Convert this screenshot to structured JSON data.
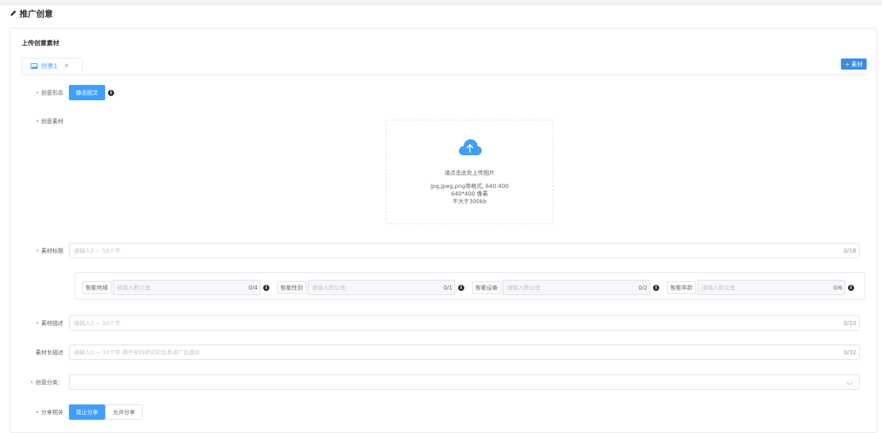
{
  "page": {
    "title": "推广创意"
  },
  "panel": {
    "section_title": "上传创意素材"
  },
  "tab": {
    "label": "创意1",
    "close": "×"
  },
  "add_button": {
    "label": "+ 素材"
  },
  "form": {
    "form_type": {
      "label": "创意形态",
      "button": "静态图文"
    },
    "material": {
      "label": "创意素材"
    },
    "upload": {
      "line1": "请点击此处上传图片",
      "line2": "jpg,jpeg,png等格式, 640:400",
      "line3": "640*400 像素",
      "line4": "不大于300kb"
    },
    "title": {
      "label": "素材标题",
      "placeholder": "请输入2 ~ 18个字",
      "count": "0/18"
    },
    "smart": [
      {
        "tag": "智能地域",
        "placeholder": "请输入默认值",
        "count": "0/4"
      },
      {
        "tag": "智能性别",
        "placeholder": "请输入默认值",
        "count": "0/1"
      },
      {
        "tag": "智能设备",
        "placeholder": "请输入默认值",
        "count": "0/2"
      },
      {
        "tag": "智能年龄",
        "placeholder": "请输入默认值",
        "count": "0/6"
      }
    ],
    "desc": {
      "label": "素材描述",
      "placeholder": "请输入2 ~ 10个字",
      "count": "0/10"
    },
    "long_desc": {
      "label": "素材长描述",
      "placeholder": "请输入0 ~ 32个字,用于单列样式的信息流广告展示",
      "count": "0/32"
    },
    "category": {
      "label": "创意分类：",
      "value": ""
    },
    "share": {
      "label": "分享相关",
      "options": [
        "禁止分享",
        "允许分享"
      ]
    }
  },
  "colors": {
    "primary": "#409eff",
    "required": "#f56c6c",
    "border": "#dcdfe6"
  }
}
